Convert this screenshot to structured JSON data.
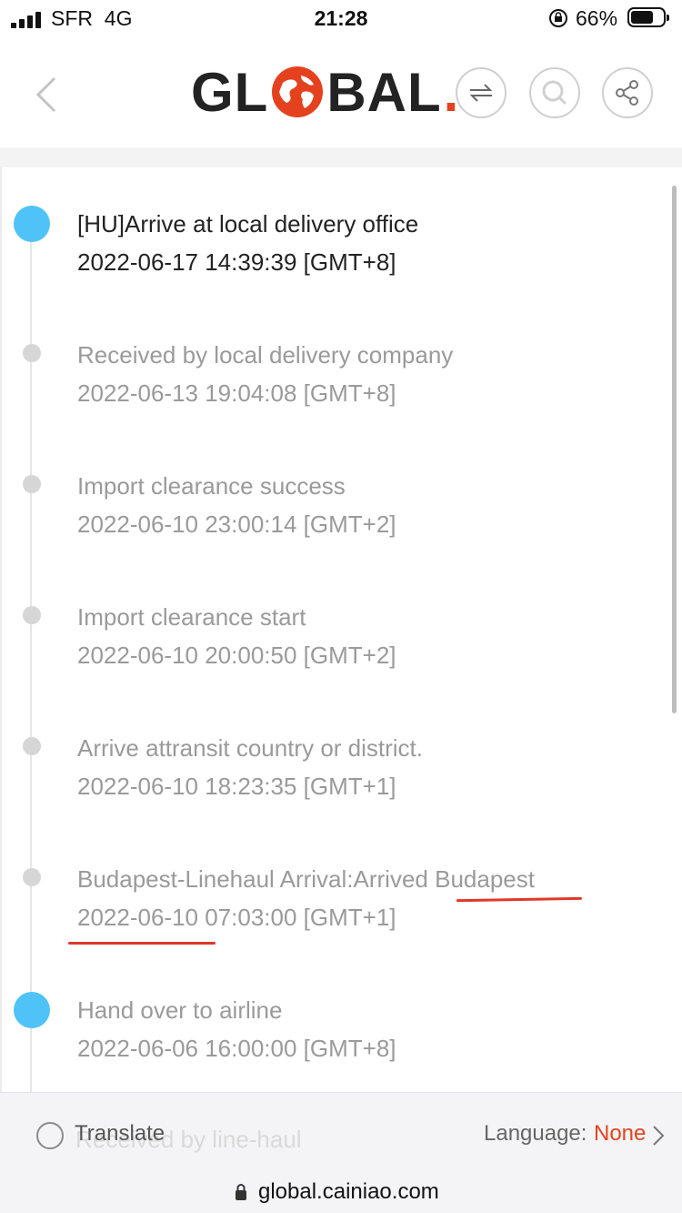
{
  "status_bar": {
    "carrier": "SFR",
    "network": "4G",
    "time": "21:28",
    "battery": "66%",
    "battery_level": 0.66
  },
  "header": {
    "logo_left": "GL",
    "logo_right": "BAL",
    "logo_dot": ".",
    "icons": [
      "back-arrow-icon",
      "swap-icon",
      "search-icon",
      "share-icon"
    ],
    "brand_color": "#e4421f"
  },
  "timeline": {
    "events": [
      {
        "title": "[HU]Arrive at local delivery office",
        "time": "2022-06-17 14:39:39 [GMT+8]",
        "active": true
      },
      {
        "title": "Received by local delivery company",
        "time": "2022-06-13 19:04:08 [GMT+8]",
        "active": false
      },
      {
        "title": "Import clearance success",
        "time": "2022-06-10 23:00:14 [GMT+2]",
        "active": false
      },
      {
        "title": "Import clearance start",
        "time": "2022-06-10 20:00:50 [GMT+2]",
        "active": false
      },
      {
        "title": "Arrive attransit country or district.",
        "time": "2022-06-10 18:23:35 [GMT+1]",
        "active": false
      },
      {
        "title": "Budapest-Linehaul Arrival:Arrived Budapest",
        "time": "2022-06-10 07:03:00 [GMT+1]",
        "active": false
      },
      {
        "title": "Hand over to airline",
        "time": "2022-06-06 16:00:00 [GMT+8]",
        "active": false,
        "big_dot": true
      }
    ],
    "partially_hidden": {
      "title": "Received by line-haul"
    },
    "dot_color": "#4fc3f7",
    "annotation_color": "#e0382a"
  },
  "translate_bar": {
    "translate_label": "Translate",
    "language_label": "Language:",
    "language_value": "None"
  },
  "url_bar": {
    "url": "global.cainiao.com"
  }
}
